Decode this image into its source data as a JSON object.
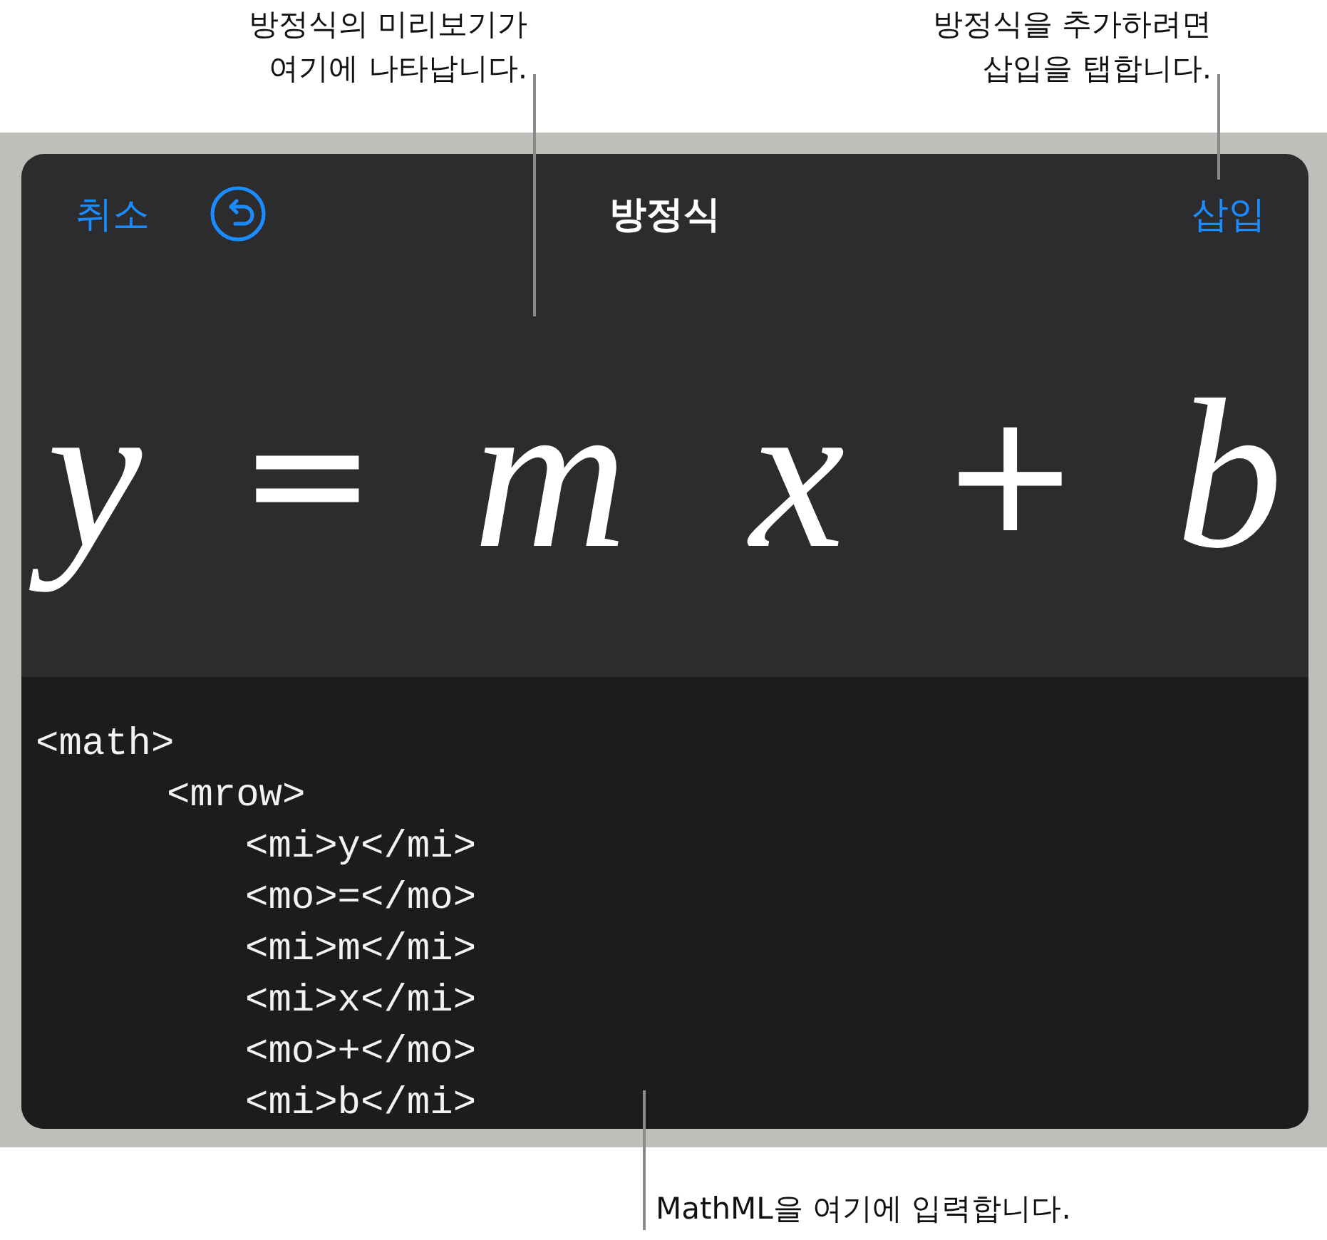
{
  "preview_callout": "방정식의 미리보기가\n여기에 나타납니다.",
  "insert_callout": "방정식을 추가하려면\n삽입을 탭합니다.",
  "input_callout": "MathML을 여기에 입력합니다.",
  "header": {
    "cancel": "취소",
    "title": "방정식",
    "insert": "삽입"
  },
  "equation": [
    {
      "kind": "var",
      "text": "y"
    },
    {
      "kind": "op",
      "text": "="
    },
    {
      "kind": "var",
      "text": "m"
    },
    {
      "kind": "var",
      "text": "x"
    },
    {
      "kind": "op",
      "text": "+"
    },
    {
      "kind": "var",
      "text": "b"
    }
  ],
  "code": [
    {
      "text": "<math>",
      "children": [
        {
          "text": "<mrow>",
          "children": [
            {
              "text": "<mi>y</mi>"
            },
            {
              "text": "<mo>=</mo>"
            },
            {
              "text": "<mi>m</mi>"
            },
            {
              "text": "<mi>x</mi>"
            },
            {
              "text": "<mo>+</mo>"
            },
            {
              "text": "<mi>b</mi>"
            }
          ]
        }
      ]
    }
  ]
}
